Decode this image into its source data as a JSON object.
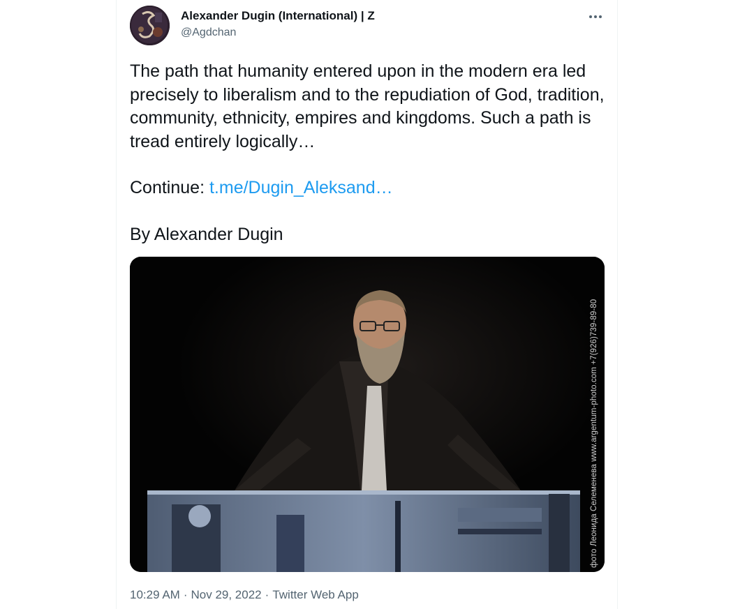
{
  "author": {
    "name": "Alexander Dugin (International) | Z",
    "handle": "@Agdchan"
  },
  "tweet": {
    "text": "The path that humanity entered upon in the modern era led precisely to liberalism and to the repudiation of God, tradition, community, ethnicity, empires and kingdoms. Such a path is tread entirely logically…",
    "continue_label": "Continue:",
    "continue_link": "t.me/Dugin_Aleksand…",
    "byline": "By Alexander Dugin"
  },
  "media": {
    "watermark": "фото Леонида Селеменева www.argentum-photo.com +7(926)739-89-80"
  },
  "meta": {
    "time": "10:29 AM",
    "date": "Nov 29, 2022",
    "source": "Twitter Web App",
    "separator": "·"
  },
  "colors": {
    "text": "#0f1419",
    "secondary": "#536471",
    "link": "#1d9bf0"
  },
  "icons": {
    "more": "more-horizontal-icon"
  }
}
